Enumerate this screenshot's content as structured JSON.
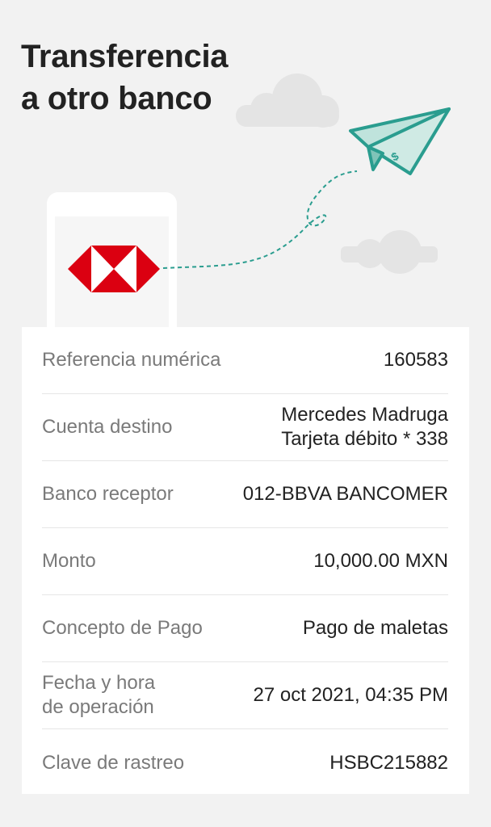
{
  "header": {
    "title_line1": "Transferencia",
    "title_line2": "a otro banco"
  },
  "colors": {
    "brand_red": "#db0011",
    "plane_teal": "#2a9d8f",
    "plane_fill": "#bfe3dc",
    "cloud": "#e4e4e4",
    "background": "#f2f2f2"
  },
  "icons": {
    "logo": "hsbc-logo-icon",
    "plane": "paper-plane-icon",
    "phone": "phone-icon",
    "cloud": "cloud-icon"
  },
  "details": {
    "reference": {
      "label": "Referencia numérica",
      "value": "160583"
    },
    "account": {
      "label": "Cuenta destino",
      "value_line1": "Mercedes Madruga",
      "value_line2": "Tarjeta débito * 338"
    },
    "bank": {
      "label": "Banco receptor",
      "value": "012-BBVA BANCOMER"
    },
    "amount": {
      "label": "Monto",
      "value": "10,000.00 MXN"
    },
    "concept": {
      "label": "Concepto de Pago",
      "value": "Pago de maletas"
    },
    "date": {
      "label_line1": "Fecha y hora",
      "label_line2": "de operación",
      "value": "27 oct 2021, 04:35 PM"
    },
    "tracking": {
      "label": "Clave de rastreo",
      "value": "HSBC215882"
    }
  }
}
